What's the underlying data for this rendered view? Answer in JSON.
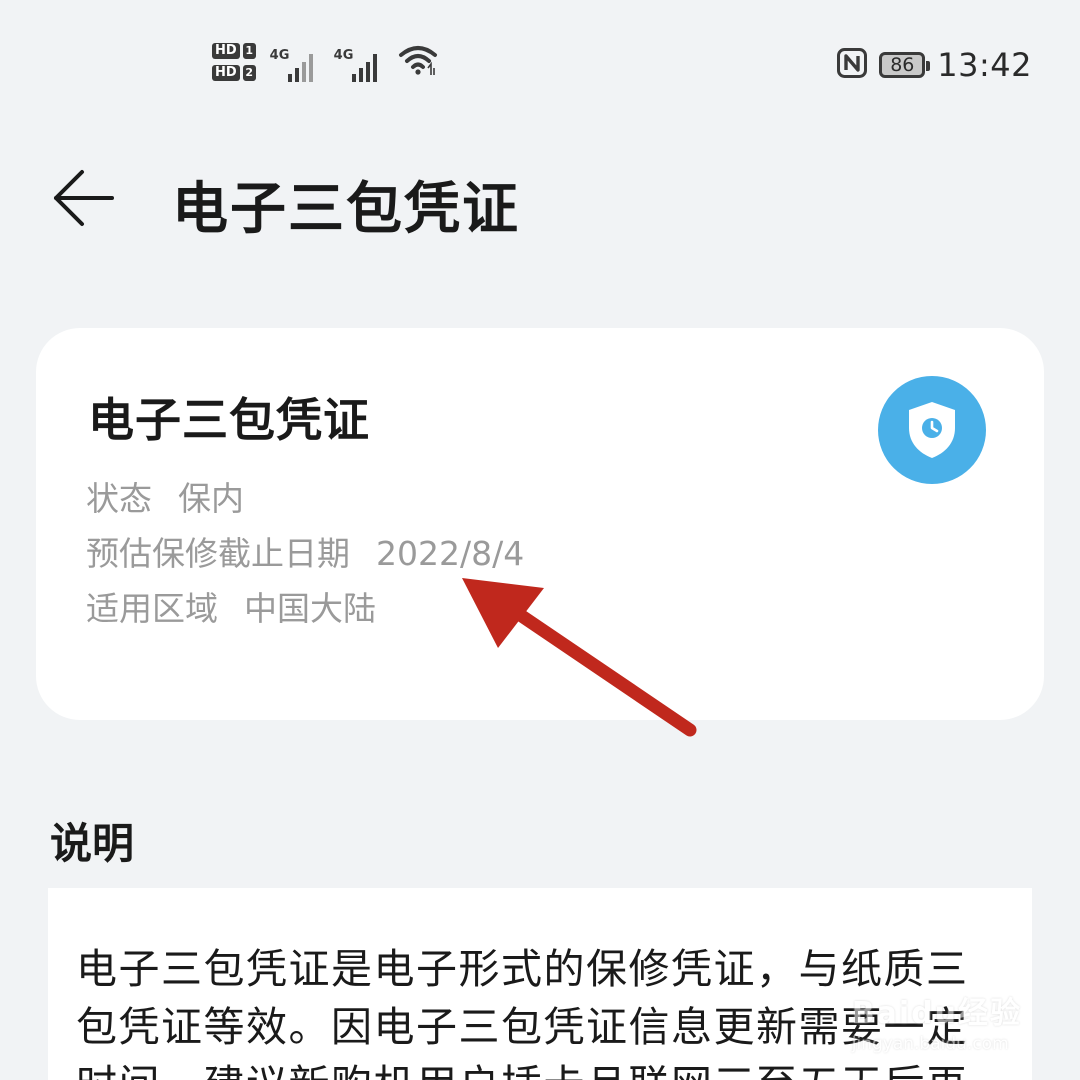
{
  "status_bar": {
    "sim1_label": "HD",
    "sim1_num": "1",
    "sim2_label": "HD",
    "sim2_num": "2",
    "network1": "4G",
    "network2": "4G",
    "battery": "86",
    "time": "13:42",
    "icons": [
      "nfc-icon",
      "wifi-icon",
      "signal-icon",
      "battery-icon"
    ]
  },
  "header": {
    "title": "电子三包凭证"
  },
  "card": {
    "title": "电子三包凭证",
    "status_label": "状态",
    "status_value": "保内",
    "date_label": "预估保修截止日期",
    "date_value": "2022/8/4",
    "region_label": "适用区域",
    "region_value": "中国大陆",
    "icon_color": "#4ab0e8"
  },
  "description": {
    "title": "说明",
    "text": "电子三包凭证是电子形式的保修凭证，与纸质三包凭证等效。因电子三包凭证信息更新需要一定时间，建议新购机用户插卡且联网三至五天后再"
  },
  "annotation": {
    "arrow_color": "#c0281d"
  },
  "watermark": {
    "brand": "Baidu经验",
    "url": "jingyan.baidu.com"
  }
}
